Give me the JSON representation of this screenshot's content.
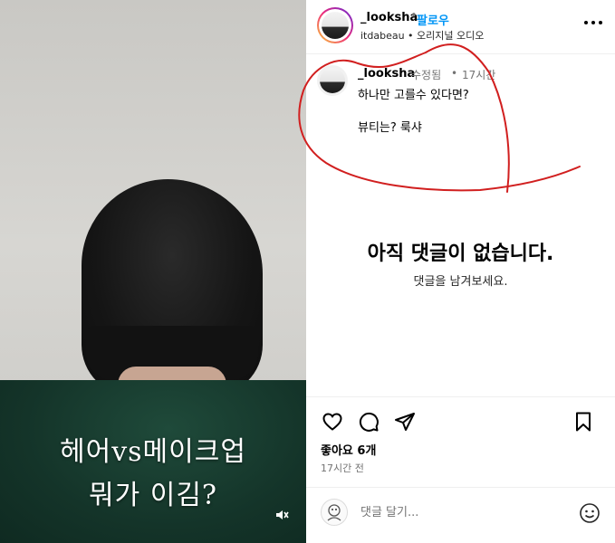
{
  "post": {
    "overlay_line1": "헤어vs메이크업",
    "overlay_line2": "뭐가 이김?"
  },
  "header": {
    "username": "_looksha",
    "dot": "•",
    "follow_label": "팔로우",
    "subtitle": "itdabeau • 오리지널 오디오"
  },
  "caption": {
    "username": "_looksha",
    "edited": "수정됨",
    "dot": "•",
    "time": "17시간",
    "line1": "하나만 고를수 있다면?",
    "line2": "뷰티는? 룩샤"
  },
  "comments_empty": {
    "title": "아직 댓글이 없습니다.",
    "subtitle": "댓글을 남겨보세요."
  },
  "engagement": {
    "likes": "좋아요 6개",
    "posted": "17시간 전"
  },
  "comment_box": {
    "placeholder": "댓글 달기..."
  },
  "icons": {
    "more": "more-horizontal-icon",
    "like": "heart-icon",
    "comment": "comment-bubble-icon",
    "share": "paper-plane-icon",
    "save": "bookmark-icon",
    "mute": "speaker-muted-icon",
    "emoji": "smiley-icon"
  },
  "colors": {
    "follow": "#0095f6",
    "annotation": "#d11f1f",
    "secondary_text": "#737373"
  }
}
